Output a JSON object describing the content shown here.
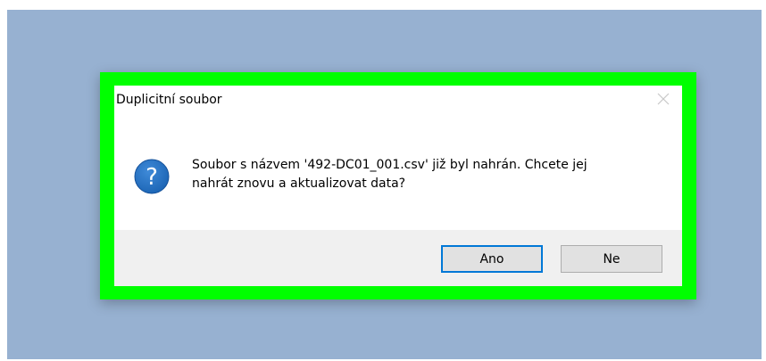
{
  "dialog": {
    "title": "Duplicitní soubor",
    "message": "Soubor s názvem '492-DC01_001.csv' již byl nahrán. Chcete jej\nnahrát znovu a aktualizovat data?",
    "icon": "question-icon",
    "buttons": {
      "yes_label": "Ano",
      "no_label": "Ne"
    }
  },
  "colors": {
    "desktop": "#97b1d1",
    "highlight_frame": "#00ff00",
    "accent": "#0078d7",
    "icon_blue": "#1b64b4"
  }
}
